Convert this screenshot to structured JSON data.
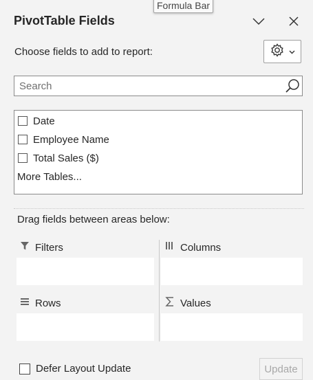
{
  "tooltip": {
    "text": "Formula Bar"
  },
  "pane": {
    "title": "PivotTable Fields",
    "choose_label": "Choose fields to add to report:",
    "icons": {
      "collapse": "chevron-down-icon",
      "close": "close-icon",
      "tools": "gear-icon",
      "tools_dropdown": "chevron-down-icon"
    }
  },
  "search": {
    "placeholder": "Search",
    "value": "",
    "icon": "search-icon"
  },
  "fields": [
    {
      "label": "Date",
      "checked": false
    },
    {
      "label": "Employee Name",
      "checked": false
    },
    {
      "label": "Total Sales ($)",
      "checked": false
    }
  ],
  "more_tables": "More Tables...",
  "areas": {
    "instruction": "Drag fields between areas below:",
    "filters": {
      "label": "Filters",
      "icon": "filter-icon"
    },
    "columns": {
      "label": "Columns",
      "icon": "columns-icon"
    },
    "rows": {
      "label": "Rows",
      "icon": "rows-icon"
    },
    "values": {
      "label": "Values",
      "icon": "sigma-icon"
    }
  },
  "footer": {
    "defer_label": "Defer Layout Update",
    "defer_checked": false,
    "update_label": "Update"
  }
}
